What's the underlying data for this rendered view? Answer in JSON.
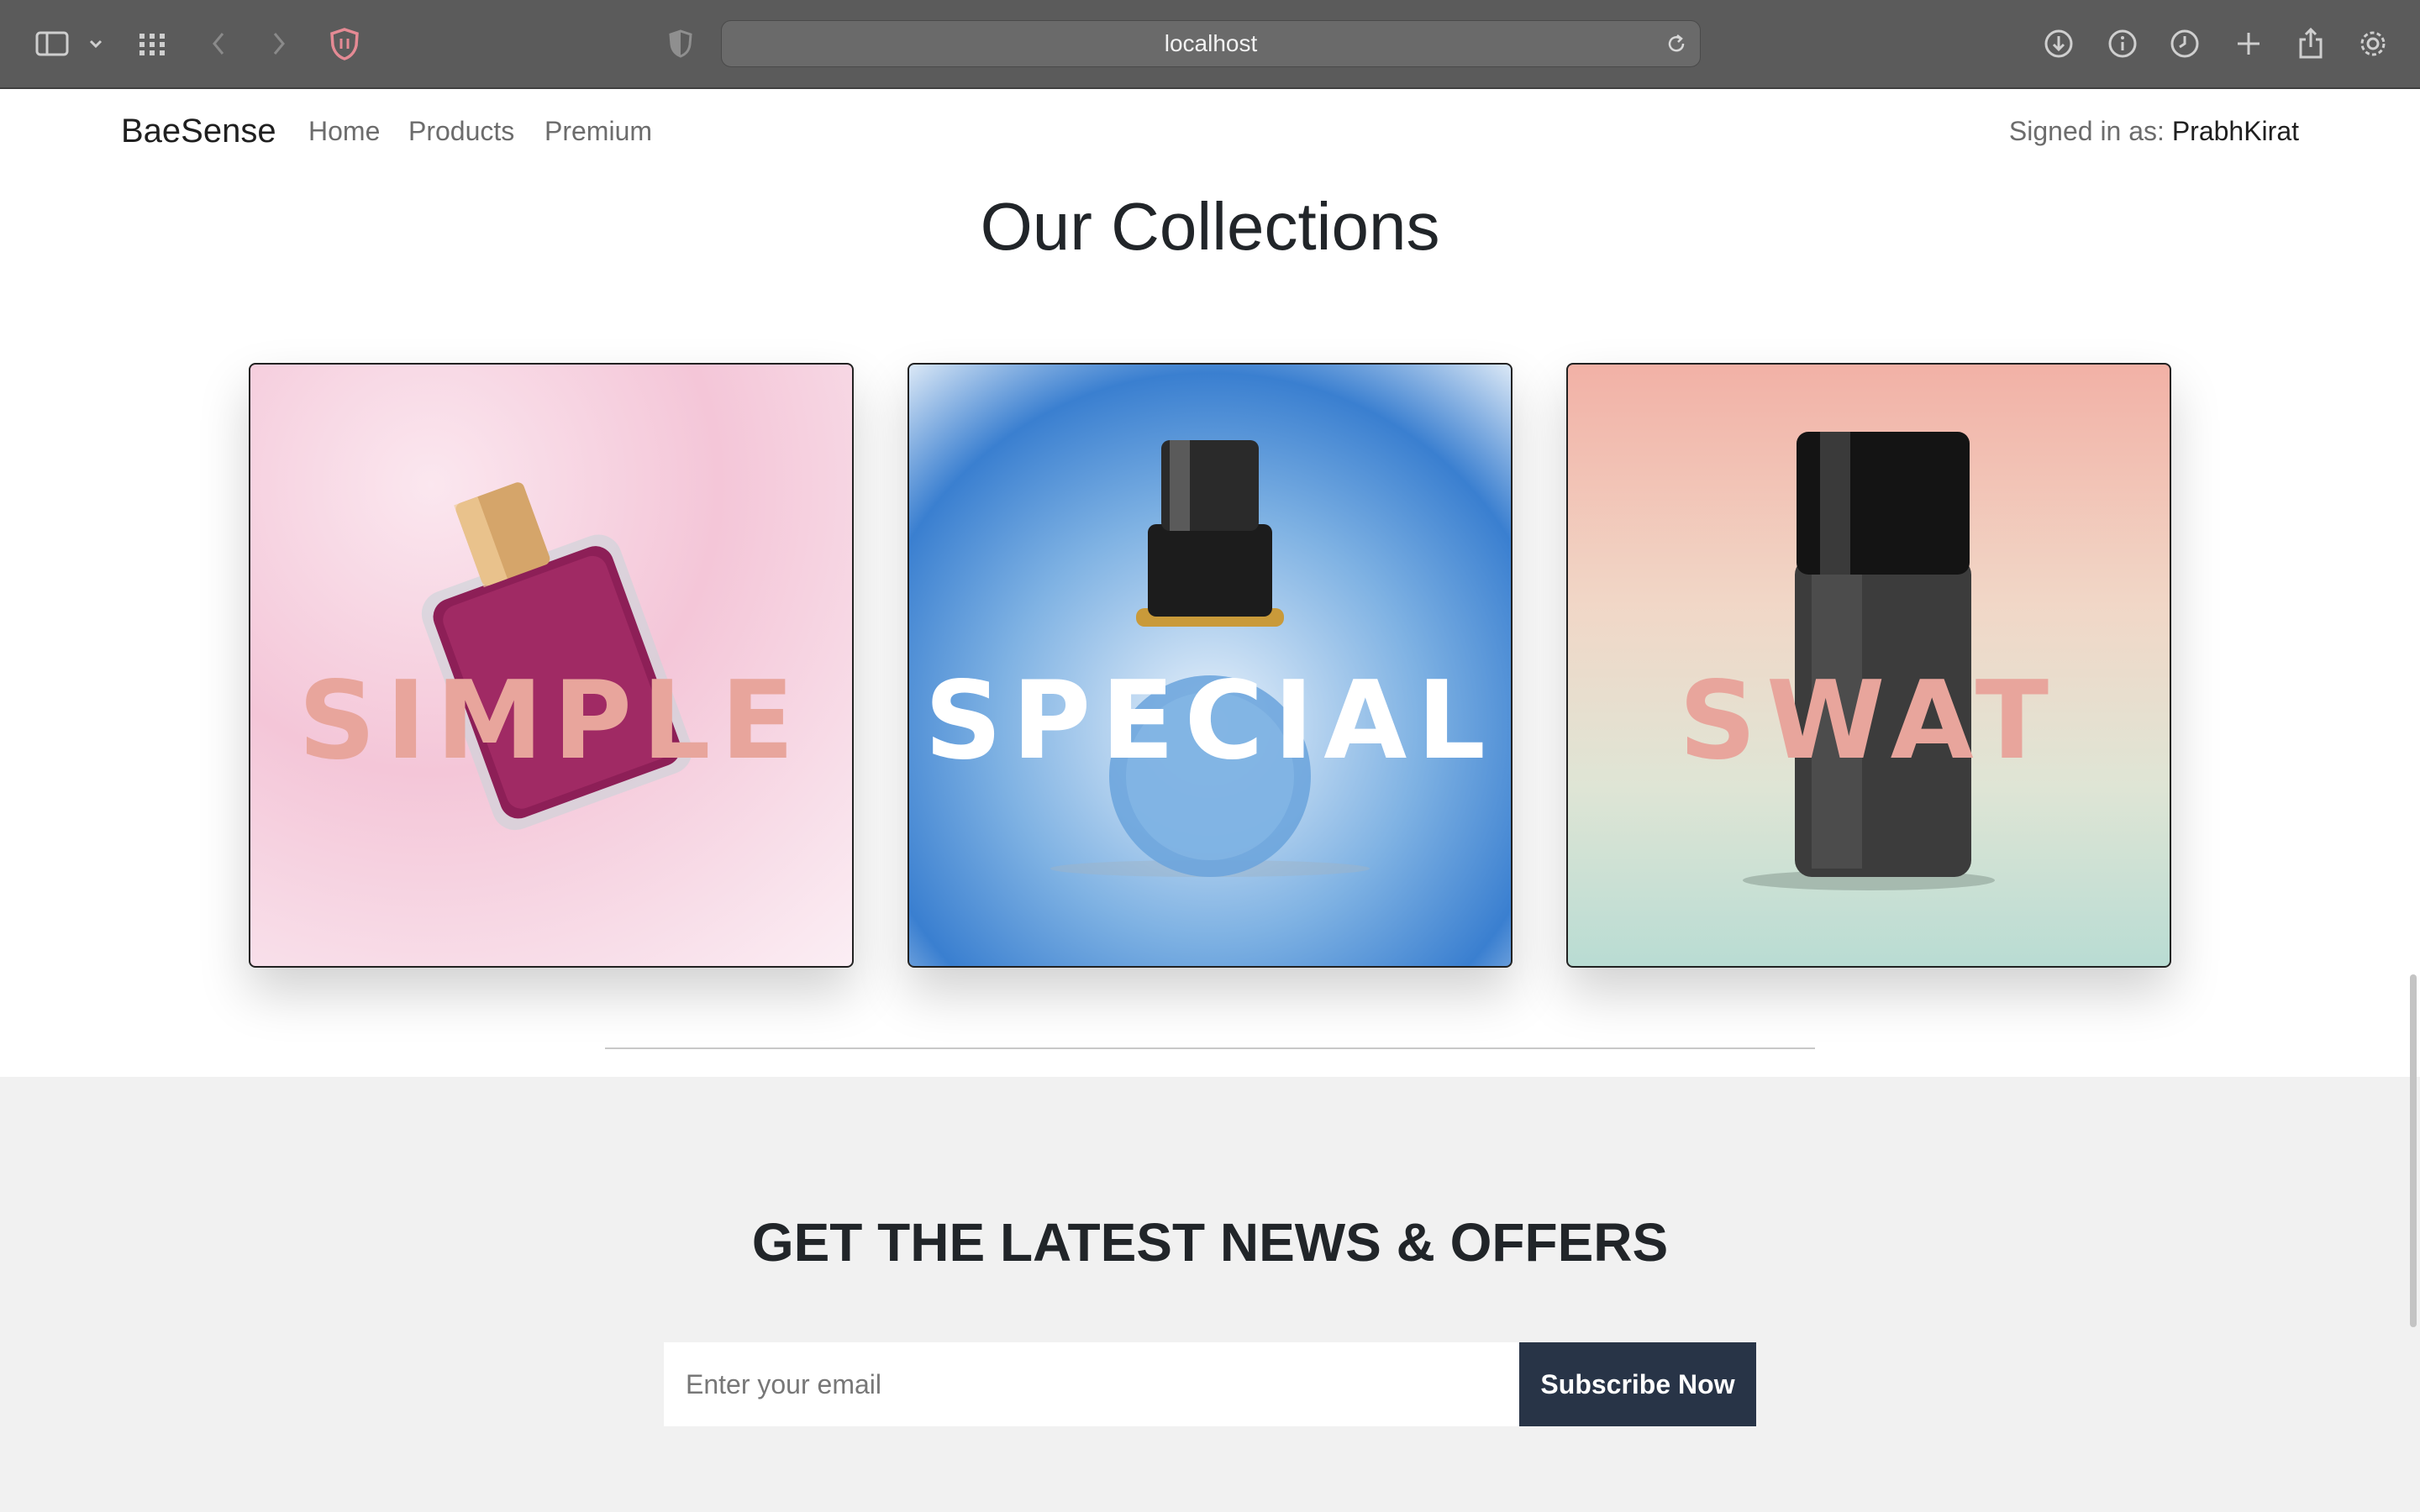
{
  "browser": {
    "url": "localhost"
  },
  "navbar": {
    "brand": "BaeSense",
    "links": [
      "Home",
      "Products",
      "Premium"
    ],
    "signed_prefix": "Signed in as: ",
    "user": "PrabhKirat"
  },
  "collections": {
    "title": "Our Collections",
    "cards": [
      {
        "label": "SIMPLE",
        "label_color": "#e8a59c"
      },
      {
        "label": "SPECIAL",
        "label_color": "#ffffff"
      },
      {
        "label": "SWAT",
        "label_color": "#e8a59c"
      }
    ]
  },
  "newsletter": {
    "title": "GET THE LATEST NEWS & OFFERS",
    "email_placeholder": "Enter your email",
    "button": "Subscribe Now"
  }
}
